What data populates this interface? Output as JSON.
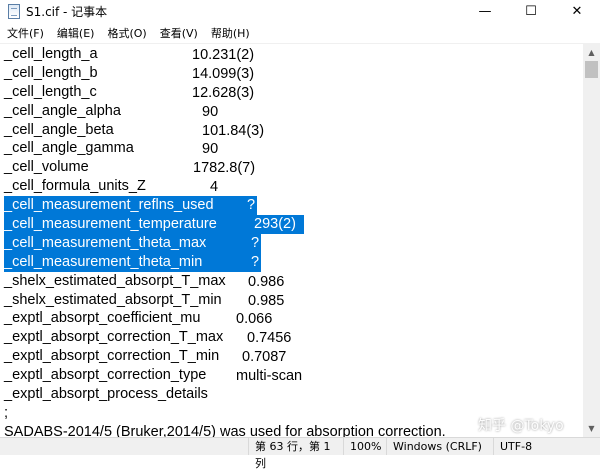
{
  "window": {
    "title": "S1.cif - 记事本",
    "minimize_glyph": "—",
    "maximize_glyph": "☐",
    "close_glyph": "✕"
  },
  "menu": [
    "文件(F)",
    "编辑(E)",
    "格式(O)",
    "查看(V)",
    "帮助(H)"
  ],
  "lines": [
    {
      "key": "_cell_length_a",
      "value": "10.231(2)",
      "selected": false
    },
    {
      "key": "_cell_length_b",
      "value": "14.099(3)",
      "selected": false
    },
    {
      "key": "_cell_length_c",
      "value": "12.628(3)",
      "selected": false
    },
    {
      "key": "_cell_angle_alpha",
      "value": "90",
      "selected": false
    },
    {
      "key": "_cell_angle_beta",
      "value": "101.84(3)",
      "selected": false
    },
    {
      "key": "_cell_angle_gamma",
      "value": "90",
      "selected": false
    },
    {
      "key": "_cell_volume",
      "value": "1782.8(7)",
      "selected": false
    },
    {
      "key": "_cell_formula_units_Z",
      "value": "4",
      "selected": false
    },
    {
      "key": "_cell_measurement_reflns_used",
      "value": "?",
      "selected": true
    },
    {
      "key": "_cell_measurement_temperature",
      "value": "293(2)",
      "selected": true
    },
    {
      "key": "_cell_measurement_theta_max",
      "value": "?",
      "selected": true
    },
    {
      "key": "_cell_measurement_theta_min",
      "value": "?",
      "selected": true
    },
    {
      "key": "_shelx_estimated_absorpt_T_max",
      "value": "0.986",
      "selected": false
    },
    {
      "key": "_shelx_estimated_absorpt_T_min",
      "value": "0.985",
      "selected": false
    },
    {
      "key": "_exptl_absorpt_coefficient_mu",
      "value": "0.066",
      "selected": false
    },
    {
      "key": "_exptl_absorpt_correction_T_max",
      "value": "0.7456",
      "selected": false
    },
    {
      "key": "_exptl_absorpt_correction_T_min",
      "value": "0.7087",
      "selected": false
    },
    {
      "key": "_exptl_absorpt_correction_type",
      "value": "multi-scan",
      "selected": false
    },
    {
      "key": "_exptl_absorpt_process_details",
      "value": "",
      "selected": false
    },
    {
      "key": ";",
      "value": "",
      "selected": false
    },
    {
      "key": "SADABS-2014/5 (Bruker,2014/5) was used for absorption correction.",
      "value": "",
      "selected": false
    }
  ],
  "status": {
    "position": "第 63 行，第 1 列",
    "zoom": "100%",
    "line_ending": "Windows (CRLF)",
    "encoding": "UTF-8"
  },
  "watermark": "知乎 @Tokyo",
  "colors": {
    "selection": "#0078d7"
  }
}
